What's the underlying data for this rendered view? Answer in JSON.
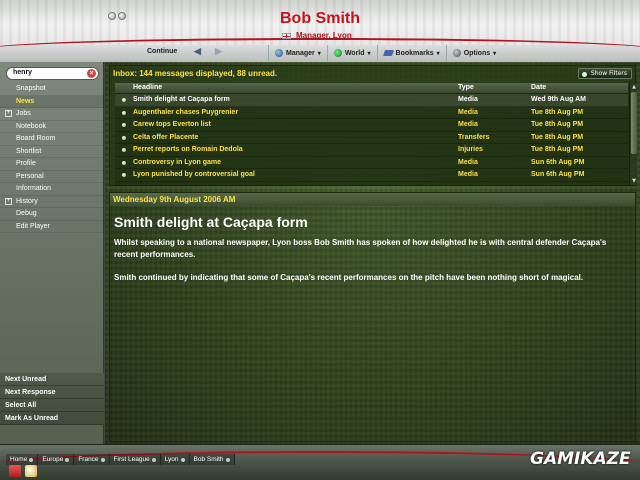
{
  "header": {
    "title": "Bob Smith",
    "subtitle": "Manager, Lyon",
    "continue_label": "Continue",
    "menu": [
      {
        "label": "Manager"
      },
      {
        "label": "World"
      },
      {
        "label": "Bookmarks"
      },
      {
        "label": "Options"
      }
    ]
  },
  "sidebar": {
    "search_value": "henry",
    "items": [
      {
        "label": "Snapshot"
      },
      {
        "label": "News"
      },
      {
        "label": "Jobs"
      },
      {
        "label": "Notebook"
      },
      {
        "label": "Board Room"
      },
      {
        "label": "Shortlist"
      },
      {
        "label": "Profile"
      },
      {
        "label": "Personal"
      },
      {
        "label": "Information"
      },
      {
        "label": "History"
      },
      {
        "label": "Debug"
      },
      {
        "label": "Edit Player"
      }
    ],
    "actions": [
      {
        "label": "Next Unread"
      },
      {
        "label": "Next Response"
      },
      {
        "label": "Select All"
      },
      {
        "label": "Mark As Unread"
      }
    ]
  },
  "inbox": {
    "summary": "Inbox: 144 messages displayed, 88 unread.",
    "show_filters_label": "Show Filters",
    "columns": {
      "headline": "Headline",
      "type": "Type",
      "date": "Date"
    },
    "rows": [
      {
        "headline": "Smith delight at Caçapa form",
        "type": "Media",
        "date": "Wed 9th Aug AM"
      },
      {
        "headline": "Augenthaler chases Puygrenier",
        "type": "Media",
        "date": "Tue 8th Aug PM"
      },
      {
        "headline": "Carew tops Everton list",
        "type": "Media",
        "date": "Tue 8th Aug PM"
      },
      {
        "headline": "Celta offer Placente",
        "type": "Transfers",
        "date": "Tue 8th Aug PM"
      },
      {
        "headline": "Perret reports on Romain Dedola",
        "type": "Injuries",
        "date": "Tue 8th Aug PM"
      },
      {
        "headline": "Controversy in Lyon game",
        "type": "Media",
        "date": "Sun 6th Aug PM"
      },
      {
        "headline": "Lyon punished by controversial goal",
        "type": "Media",
        "date": "Sun 6th Aug PM"
      }
    ]
  },
  "message": {
    "date": "Wednesday 9th August 2006 AM",
    "title": "Smith delight at Caçapa form",
    "paragraphs": [
      "Whilst speaking to a national newspaper, Lyon boss Bob Smith has spoken of how delighted he is with central defender Caçapa's recent performances.",
      "Smith continued by indicating that some of Caçapa's recent performances on the pitch have been nothing short of magical."
    ]
  },
  "footer": {
    "breadcrumbs": [
      {
        "label": "Home"
      },
      {
        "label": "Europe"
      },
      {
        "label": "France"
      },
      {
        "label": "First League"
      },
      {
        "label": "Lyon"
      },
      {
        "label": "Bob Smith"
      }
    ],
    "watermark": "GAMIKAZE"
  },
  "colors": {
    "accent_red": "#c0141c",
    "unread_yellow": "#ffe04a"
  }
}
